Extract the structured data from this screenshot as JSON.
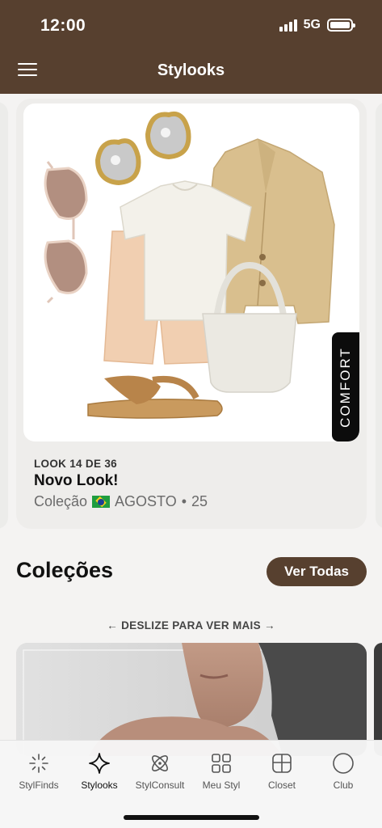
{
  "status_bar": {
    "time": "12:00",
    "network": "5G"
  },
  "header": {
    "title": "Stylooks",
    "menu_icon": "hamburger-menu-icon"
  },
  "look": {
    "counter": "LOOK 14 DE 36",
    "name": "Novo Look!",
    "collection_label": "Coleção",
    "collection_flag": "brazil-flag-icon",
    "collection_month": "AGOSTO",
    "separator": "•",
    "collection_year": "25",
    "tag": "COMFORT"
  },
  "collections": {
    "title": "Coleções",
    "view_all_label": "Ver Todas",
    "swipe_hint": "← DESLIZE PARA VER MAIS →"
  },
  "bottom_nav": {
    "items": [
      {
        "label": "StylFinds",
        "icon": "sparkle-burst-icon"
      },
      {
        "label": "Stylooks",
        "icon": "four-point-star-icon",
        "active": true
      },
      {
        "label": "StylConsult",
        "icon": "atom-icon"
      },
      {
        "label": "Meu Styl",
        "icon": "grid-icon"
      },
      {
        "label": "Closet",
        "icon": "closet-icon"
      },
      {
        "label": "Club",
        "icon": "circle-icon"
      }
    ]
  },
  "colors": {
    "brand_brown": "#57402f",
    "background": "#f4f3f2",
    "card": "#eeedeb",
    "tag_black": "#0c0c0c"
  }
}
